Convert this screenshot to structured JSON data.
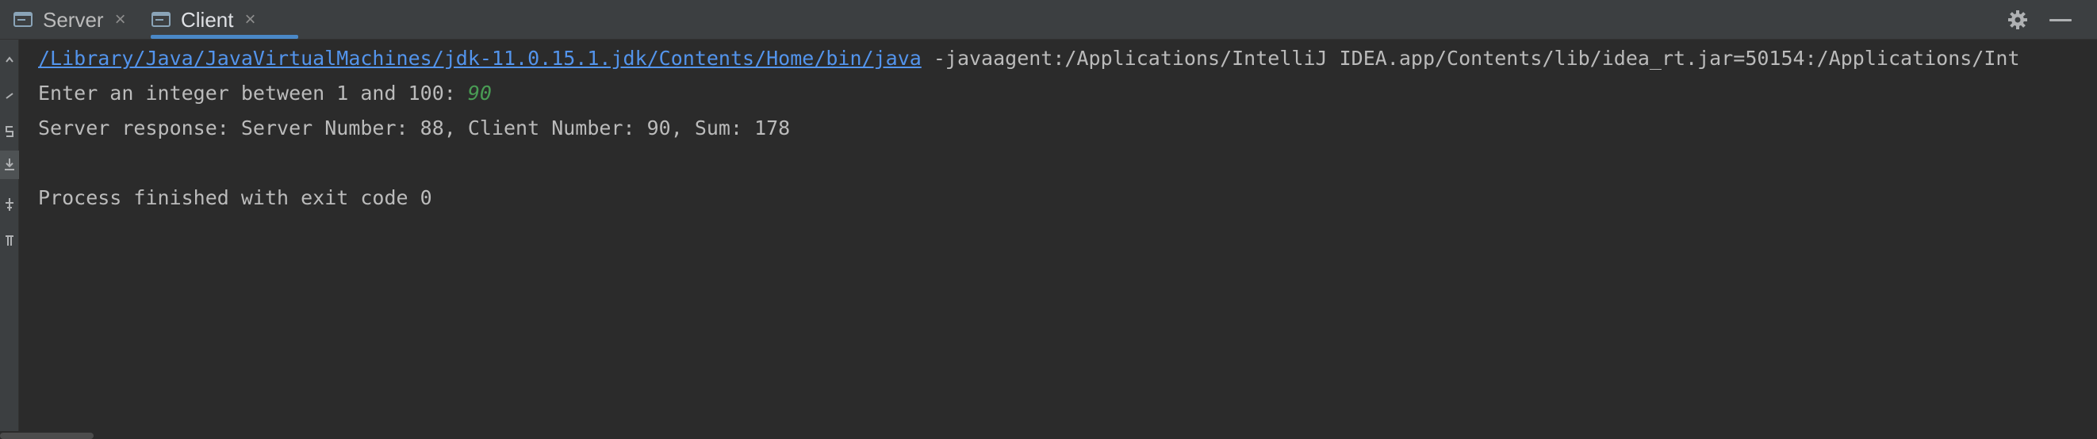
{
  "tabs": [
    {
      "label": "Server",
      "icon": "console-icon",
      "close": "×"
    },
    {
      "label": "Client",
      "icon": "console-icon",
      "close": "×",
      "active": true
    }
  ],
  "toolbar": {
    "settings_icon": "gear-icon",
    "minimize_icon": "minimize-icon"
  },
  "sidebar": {
    "icons": [
      "arrow-up-icon",
      "check-icon",
      "rerun-icon",
      "scroll-to-end-icon",
      "pin-icon",
      "trash-icon"
    ]
  },
  "console": {
    "command_path": "/Library/Java/JavaVirtualMachines/jdk-11.0.15.1.jdk/Contents/Home/bin/java",
    "command_args": " -javaagent:/Applications/IntelliJ IDEA.app/Contents/lib/idea_rt.jar=50154:/Applications/Int",
    "prompt": "Enter an integer between 1 and 100: ",
    "user_input": "90",
    "response": "Server response: Server Number: 88, Client Number: 90, Sum: 178",
    "exit_message": "Process finished with exit code 0"
  },
  "colors": {
    "background": "#2b2b2b",
    "toolbar": "#3c3f41",
    "link": "#5394ec",
    "user_input": "#499c54",
    "text": "#bbbbbb",
    "tab_underline": "#4a88c7"
  }
}
